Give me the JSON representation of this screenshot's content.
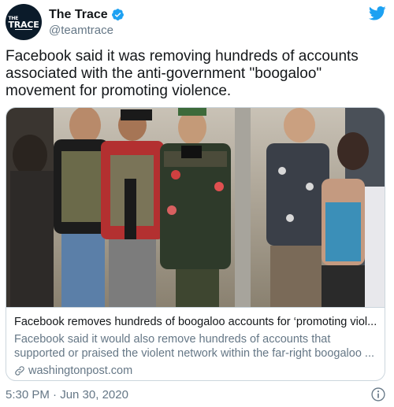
{
  "account": {
    "display_name": "The Trace",
    "handle": "@teamtrace",
    "avatar_text_small": "THE",
    "avatar_text": "TRACE"
  },
  "tweet": {
    "text": "Facebook said it was removing hundreds of accounts associated with the anti-government \"boogaloo\" movement for promoting violence."
  },
  "card": {
    "title": "Facebook removes hundreds of boogaloo accounts for ‘promoting viol...",
    "description": "Facebook said it would also remove hundreds of accounts that supported or praised the violent network within the far-right boogaloo ...",
    "domain": "washingtonpost.com"
  },
  "footer": {
    "timestamp": "5:30 PM · Jun 30, 2020"
  },
  "colors": {
    "twitter_blue": "#1da1f2",
    "text_primary": "#14171a",
    "text_secondary": "#657786",
    "border": "#ccd6dd"
  },
  "icons": {
    "verified": "verified-badge-icon",
    "bird": "twitter-bird-icon",
    "link": "link-icon",
    "info": "info-icon"
  }
}
